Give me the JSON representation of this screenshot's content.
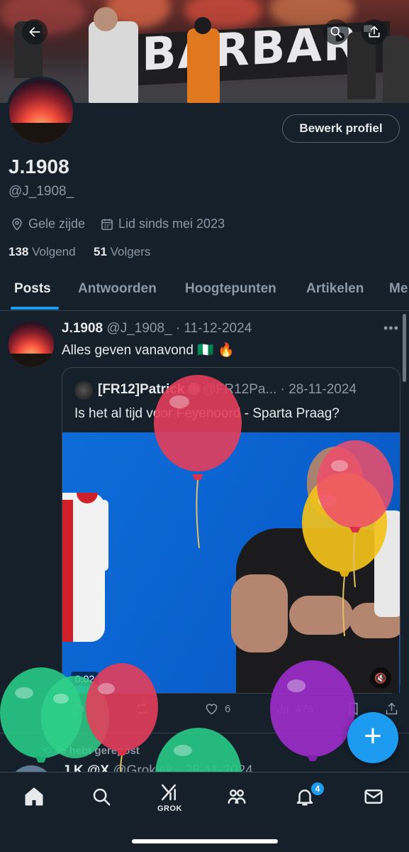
{
  "banner": {
    "text": "BARBARI",
    "back_icon": "arrow-left-icon",
    "search_icon": "search-icon",
    "share_icon": "share-icon"
  },
  "profile": {
    "edit_button": "Bewerk profiel",
    "name": "J.1908",
    "handle": "@J_1908_",
    "location": "Gele zijde",
    "joined": "Lid sinds mei 2023",
    "following_count": "138",
    "following_label": "Volgend",
    "followers_count": "51",
    "followers_label": "Volgers"
  },
  "tabs": [
    "Posts",
    "Antwoorden",
    "Hoogtepunten",
    "Artikelen",
    "Me"
  ],
  "post": {
    "name": "J.1908",
    "handle_date": "@J_1908_ · 11-12-2024",
    "text": "Alles geven vanavond 🇳🇬 🔥",
    "quote": {
      "name": "[FR12]Patrick",
      "handle_date": "@FR12Pa... · 28-11-2024",
      "text": "Is het al tijd voor Feyenoord - Sparta Praag?",
      "video_time": "0:02"
    },
    "likes": "6",
    "views": "476"
  },
  "next_post": {
    "repost_label": "Je hebt gerepost",
    "header_name": "J.K @X",
    "header_rest": "@Grokjek · 28-11-2024"
  },
  "nav": {
    "grok_label": "GROK",
    "notifications_badge": "4"
  },
  "colors": {
    "background": "#15202b",
    "accent": "#1d9bf0",
    "text_secondary": "#8b98a5",
    "border": "#38444d"
  }
}
